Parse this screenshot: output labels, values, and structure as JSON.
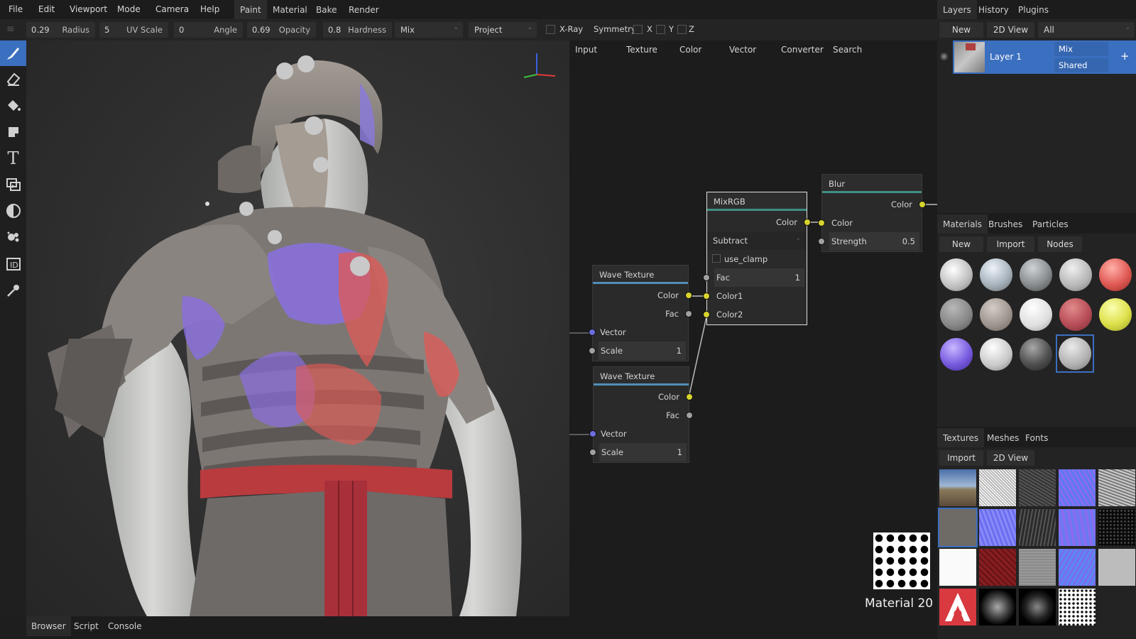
{
  "menu": [
    "File",
    "Edit",
    "Viewport",
    "Mode",
    "Camera",
    "Help"
  ],
  "workspace_tabs": [
    "Paint",
    "Material",
    "Bake",
    "Render"
  ],
  "toolbar": {
    "radius": {
      "value": "0.29",
      "label": "Radius"
    },
    "uv_scale": {
      "value": "5",
      "label": "UV Scale"
    },
    "angle": {
      "value": "0",
      "label": "Angle"
    },
    "opacity": {
      "value": "0.69",
      "label": "Opacity"
    },
    "hardness": {
      "value": "0.8",
      "label": "Hardness"
    },
    "blending": "Mix",
    "projection": "Project",
    "xray_label": "X-Ray",
    "symmetry_label": "Symmetry",
    "sym_x": "X",
    "sym_y": "Y",
    "sym_z": "Z"
  },
  "tools": [
    "brush-icon",
    "eraser-icon",
    "fill-icon",
    "decal-icon",
    "text-icon",
    "clone-icon",
    "blur-icon",
    "particle-icon",
    "colorid-icon",
    "picker-icon"
  ],
  "node_editor": {
    "tabs": [
      "Input",
      "Texture",
      "Color",
      "Vector",
      "Converter",
      "Search"
    ],
    "nodes": {
      "mixrgb": {
        "title": "MixRGB",
        "out_color": "Color",
        "blend": "Subtract",
        "clamp": "use_clamp",
        "fac_label": "Fac",
        "fac_value": "1",
        "color1": "Color1",
        "color2": "Color2"
      },
      "blur": {
        "title": "Blur",
        "out_color": "Color",
        "in_color": "Color",
        "strength_label": "Strength",
        "strength_value": "0.5"
      },
      "wave1": {
        "title": "Wave Texture",
        "out_color": "Color",
        "out_fac": "Fac",
        "in_vector": "Vector",
        "scale_label": "Scale",
        "scale_value": "1"
      },
      "wave2": {
        "title": "Wave Texture",
        "out_color": "Color",
        "out_fac": "Fac",
        "in_vector": "Vector",
        "scale_label": "Scale",
        "scale_value": "1"
      }
    },
    "preview_label": "Material 20"
  },
  "layers_panel": {
    "tabs": [
      "Layers",
      "History",
      "Plugins"
    ],
    "new_label": "New",
    "view_label": "2D View",
    "filter": "All",
    "layer": {
      "name": "Layer 1",
      "blend": "Mix",
      "mode": "Shared",
      "add": "+"
    }
  },
  "materials_panel": {
    "tabs": [
      "Materials",
      "Brushes",
      "Particles"
    ],
    "buttons": [
      "New",
      "Import",
      "Nodes"
    ]
  },
  "textures_panel": {
    "tabs": [
      "Textures",
      "Meshes",
      "Fonts"
    ],
    "buttons": [
      "Import",
      "2D View"
    ]
  },
  "bottom_tabs": [
    "Browser",
    "Script",
    "Console"
  ],
  "colors": {
    "accent": "#3b6fc0",
    "socket_yellow": "#d8d32e",
    "socket_purple": "#6d6de0"
  }
}
